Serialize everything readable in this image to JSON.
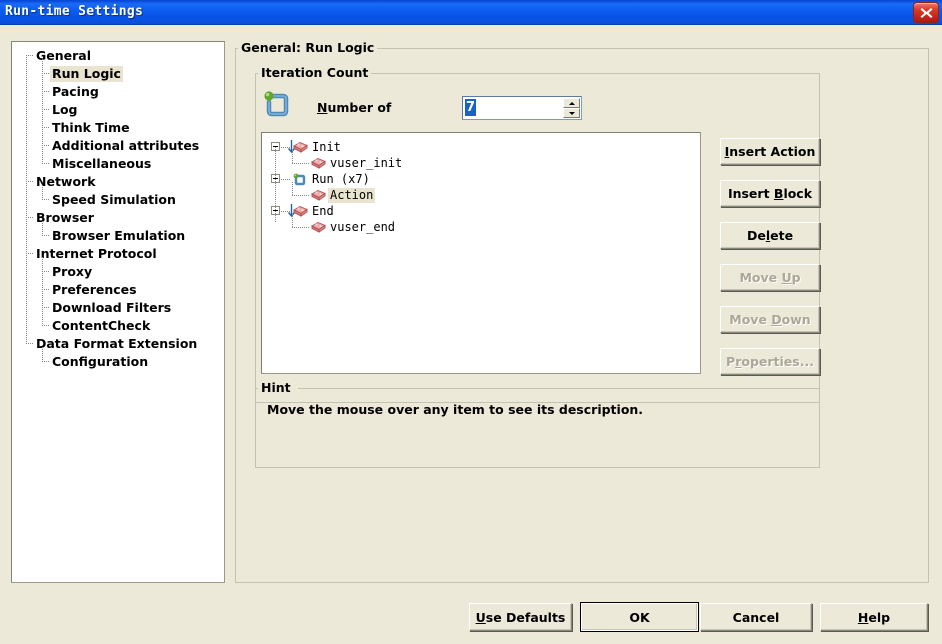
{
  "window": {
    "title": "Run-time Settings",
    "close_icon": "close-icon"
  },
  "sidebar": {
    "items": [
      {
        "label": "General",
        "level": 0
      },
      {
        "label": "Run Logic",
        "level": 1,
        "selected": true
      },
      {
        "label": "Pacing",
        "level": 1
      },
      {
        "label": "Log",
        "level": 1
      },
      {
        "label": "Think Time",
        "level": 1
      },
      {
        "label": "Additional attributes",
        "level": 1
      },
      {
        "label": "Miscellaneous",
        "level": 1
      },
      {
        "label": "Network",
        "level": 0
      },
      {
        "label": "Speed Simulation",
        "level": 1
      },
      {
        "label": "Browser",
        "level": 0
      },
      {
        "label": "Browser Emulation",
        "level": 1
      },
      {
        "label": "Internet Protocol",
        "level": 0
      },
      {
        "label": "Proxy",
        "level": 1
      },
      {
        "label": "Preferences",
        "level": 1
      },
      {
        "label": "Download Filters",
        "level": 1
      },
      {
        "label": "ContentCheck",
        "level": 1
      },
      {
        "label": "Data Format Extension",
        "level": 0
      },
      {
        "label": "Configuration",
        "level": 1
      }
    ]
  },
  "main": {
    "group_title": "General: Run Logic",
    "iteration": {
      "group_title": "Iteration Count",
      "icon": "loop-iteration-icon",
      "label_prefix": "",
      "label_accel": "N",
      "label_rest": "umber of",
      "value": "7"
    },
    "action_tree": {
      "nodes": [
        {
          "label": "Init",
          "level": 0,
          "icon": "init-block-icon",
          "expander": true
        },
        {
          "label": "vuser_init",
          "level": 1,
          "icon": "block-icon"
        },
        {
          "label": "Run (x7)",
          "level": 0,
          "icon": "loop-iteration-icon",
          "expander": true
        },
        {
          "label": "Action",
          "level": 1,
          "icon": "block-icon",
          "selected": true
        },
        {
          "label": "End",
          "level": 0,
          "icon": "end-block-icon",
          "expander": true
        },
        {
          "label": "vuser_end",
          "level": 1,
          "icon": "block-icon"
        }
      ]
    },
    "side_buttons": [
      {
        "pre": "",
        "accel": "I",
        "post": "nsert Action",
        "label": "Insert Action",
        "enabled": true,
        "name": "insert-action-button"
      },
      {
        "pre": "Insert ",
        "accel": "B",
        "post": "lock",
        "label": "Insert Block",
        "enabled": true,
        "name": "insert-block-button"
      },
      {
        "pre": "De",
        "accel": "l",
        "post": "ete",
        "label": "Delete",
        "enabled": true,
        "name": "delete-button"
      },
      {
        "pre": "Move ",
        "accel": "U",
        "post": "p",
        "label": "Move Up",
        "enabled": false,
        "name": "move-up-button"
      },
      {
        "pre": "Move ",
        "accel": "D",
        "post": "own",
        "label": "Move Down",
        "enabled": false,
        "name": "move-down-button"
      },
      {
        "pre": "P",
        "accel": "r",
        "post": "operties...",
        "label": "Properties...",
        "enabled": false,
        "name": "properties-button"
      }
    ],
    "hint": {
      "group_title": "Hint",
      "text": "Move the mouse over any item to see its description."
    }
  },
  "bottom_buttons": {
    "use_defaults": {
      "pre": "",
      "accel": "U",
      "post": "se Defaults",
      "label": "Use Defaults"
    },
    "ok": {
      "pre": "OK",
      "accel": "",
      "post": "",
      "label": "OK"
    },
    "cancel": {
      "pre": "Cancel",
      "accel": "",
      "post": "",
      "label": "Cancel"
    },
    "help": {
      "pre": "",
      "accel": "H",
      "post": "elp",
      "label": "Help"
    }
  },
  "colors": {
    "dialog_bg": "#ECE9D8",
    "titlebar_blue": "#0A5CEF",
    "selection_beige": "#E8E4D0",
    "text_selection_blue": "#1664C8",
    "close_red": "#C42314",
    "disabled_text": "#ACA899"
  }
}
